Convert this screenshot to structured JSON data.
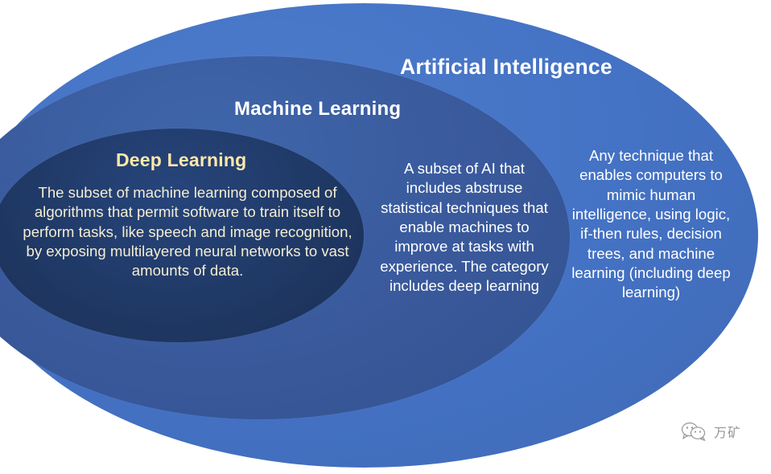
{
  "diagram": {
    "type": "nested-venn",
    "background": "#ffffff",
    "layers": [
      {
        "id": "artificial-intelligence",
        "title": "Artificial Intelligence",
        "title_color": "#ffffff",
        "fill": "#4472c4",
        "body": "Any technique that enables computers to mimic human intelligence, using logic, if-then rules, decision trees, and machine learning (including deep learning)",
        "body_color": "#ffffff"
      },
      {
        "id": "machine-learning",
        "title": "Machine Learning",
        "title_color": "#ffffff",
        "fill": "#39599b",
        "body": "A subset of AI that includes abstruse statistical techniques that enable machines to improve at tasks with experience. The category includes deep learning",
        "body_color": "#ffffff"
      },
      {
        "id": "deep-learning",
        "title": "Deep Learning",
        "title_color": "#ffe9a8",
        "fill": "#1f3864",
        "body": "The subset of machine learning composed of algorithms that permit software to train itself to perform tasks, like speech and image recognition, by exposing multilayered neural networks to vast amounts of data.",
        "body_color": "#f4edd2"
      }
    ]
  },
  "watermark": {
    "icon": "wechat-bubbles-icon",
    "text": "万矿",
    "color": "#6e6e6e"
  }
}
